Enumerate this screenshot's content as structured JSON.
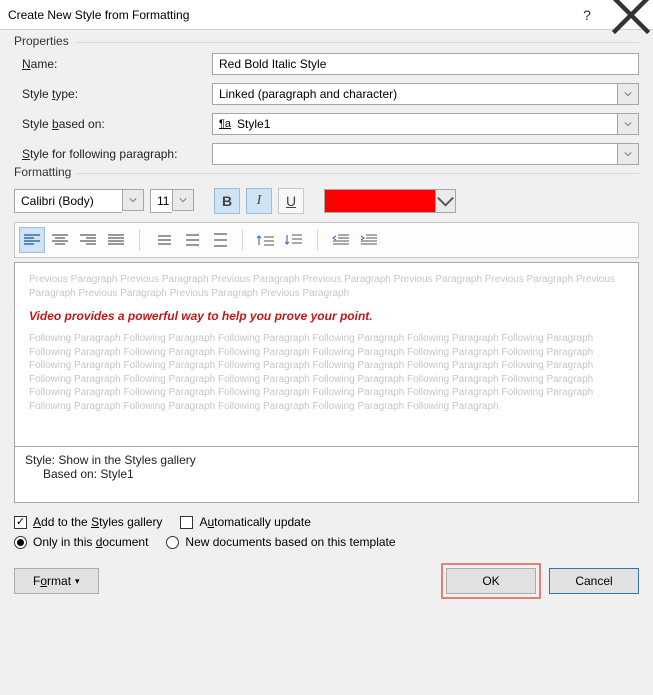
{
  "title": "Create New Style from Formatting",
  "properties": {
    "legend": "Properties",
    "name_label": "Name:",
    "name_value": "Red Bold Italic Style",
    "type_label": "Style type:",
    "type_value": "Linked (paragraph and character)",
    "based_label": "Style based on:",
    "based_value": "Style1",
    "following_label": "Style for following paragraph:",
    "following_value": ""
  },
  "formatting": {
    "legend": "Formatting",
    "font_name": "Calibri (Body)",
    "font_size": "11",
    "color": "#ff0000"
  },
  "preview": {
    "prev_text": "Previous Paragraph Previous Paragraph Previous Paragraph Previous Paragraph Previous Paragraph Previous Paragraph Previous Paragraph Previous Paragraph Previous Paragraph Previous Paragraph",
    "sample": "Video provides a powerful way to help you prove your point.",
    "next_text": "Following Paragraph Following Paragraph Following Paragraph Following Paragraph Following Paragraph Following Paragraph Following Paragraph Following Paragraph Following Paragraph Following Paragraph Following Paragraph Following Paragraph Following Paragraph Following Paragraph Following Paragraph Following Paragraph Following Paragraph Following Paragraph Following Paragraph Following Paragraph Following Paragraph Following Paragraph Following Paragraph Following Paragraph Following Paragraph Following Paragraph Following Paragraph Following Paragraph Following Paragraph Following Paragraph Following Paragraph Following Paragraph Following Paragraph Following Paragraph Following Paragraph"
  },
  "style_desc": {
    "line1": "Style: Show in the Styles gallery",
    "line2": "Based on: Style1"
  },
  "options": {
    "add_gallery": "Add to the Styles gallery",
    "auto_update": "Automatically update",
    "only_doc": "Only in this document",
    "new_docs": "New documents based on this template"
  },
  "buttons": {
    "format": "Format",
    "ok": "OK",
    "cancel": "Cancel"
  }
}
